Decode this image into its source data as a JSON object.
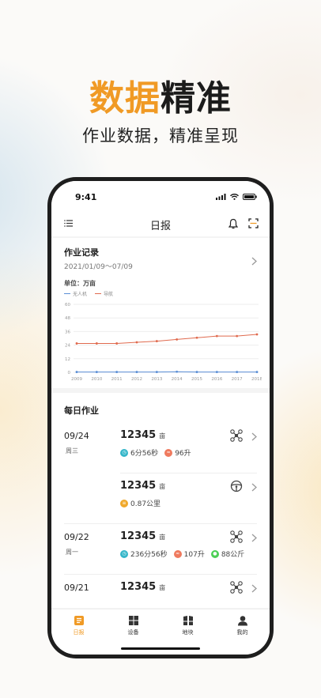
{
  "hero": {
    "title_accent": "数据",
    "title_rest": "精准",
    "subtitle": "作业数据，精准呈现"
  },
  "status": {
    "time": "9:41"
  },
  "nav": {
    "title": "日报"
  },
  "record": {
    "title": "作业记录",
    "range": "2021/01/09～07/09",
    "unit": "单位：万亩"
  },
  "colors": {
    "accent": "#f09a25",
    "series_uav": "#5b8fd6",
    "series_nav": "#e06a4e"
  },
  "chart_data": {
    "type": "line",
    "x": [
      "2009",
      "2010",
      "2011",
      "2012",
      "2013",
      "2014",
      "2015",
      "2016",
      "2017",
      "2018"
    ],
    "ylim": [
      0,
      60
    ],
    "yticks": [
      0,
      12,
      24,
      36,
      48,
      60
    ],
    "series": [
      {
        "name": "无人机",
        "values": [
          0.3,
          0.3,
          0.3,
          0.3,
          0.3,
          0.5,
          0.3,
          0.3,
          0.3,
          0.3
        ]
      },
      {
        "name": "导航",
        "values": [
          25.5,
          25.5,
          25.5,
          26.5,
          27.5,
          29,
          30.5,
          32,
          32,
          33.5
        ]
      }
    ],
    "grid": true,
    "legend_placement": "top-left"
  },
  "daily": {
    "title": "每日作业",
    "unit": "亩",
    "rows": [
      {
        "date": "09/24",
        "weekday": "周三",
        "area": "12345",
        "type_icon": "drone-icon",
        "metrics": [
          {
            "icon": "clock-icon",
            "color": "#35b6c9",
            "text": "6分56秒"
          },
          {
            "icon": "liquid-icon",
            "color": "#ef7a5e",
            "text": "96升"
          }
        ]
      },
      {
        "date": "",
        "weekday": "",
        "area": "12345",
        "type_icon": "steering-wheel-icon",
        "metrics": [
          {
            "icon": "distance-icon",
            "color": "#f0a92c",
            "text": "0.87公里"
          }
        ]
      },
      {
        "date": "09/22",
        "weekday": "周一",
        "area": "12345",
        "type_icon": "drone-icon",
        "metrics": [
          {
            "icon": "clock-icon",
            "color": "#35b6c9",
            "text": "236分56秒"
          },
          {
            "icon": "liquid-icon",
            "color": "#ef7a5e",
            "text": "107升"
          },
          {
            "icon": "weight-icon",
            "color": "#4ccf55",
            "text": "88公斤"
          }
        ]
      },
      {
        "date": "09/21",
        "weekday": "",
        "area": "12345",
        "type_icon": "drone-icon",
        "metrics": []
      }
    ]
  },
  "tabs": [
    {
      "label": "日报",
      "icon": "report-icon",
      "active": true
    },
    {
      "label": "设备",
      "icon": "device-icon",
      "active": false
    },
    {
      "label": "地块",
      "icon": "field-icon",
      "active": false
    },
    {
      "label": "我的",
      "icon": "profile-icon",
      "active": false
    }
  ]
}
